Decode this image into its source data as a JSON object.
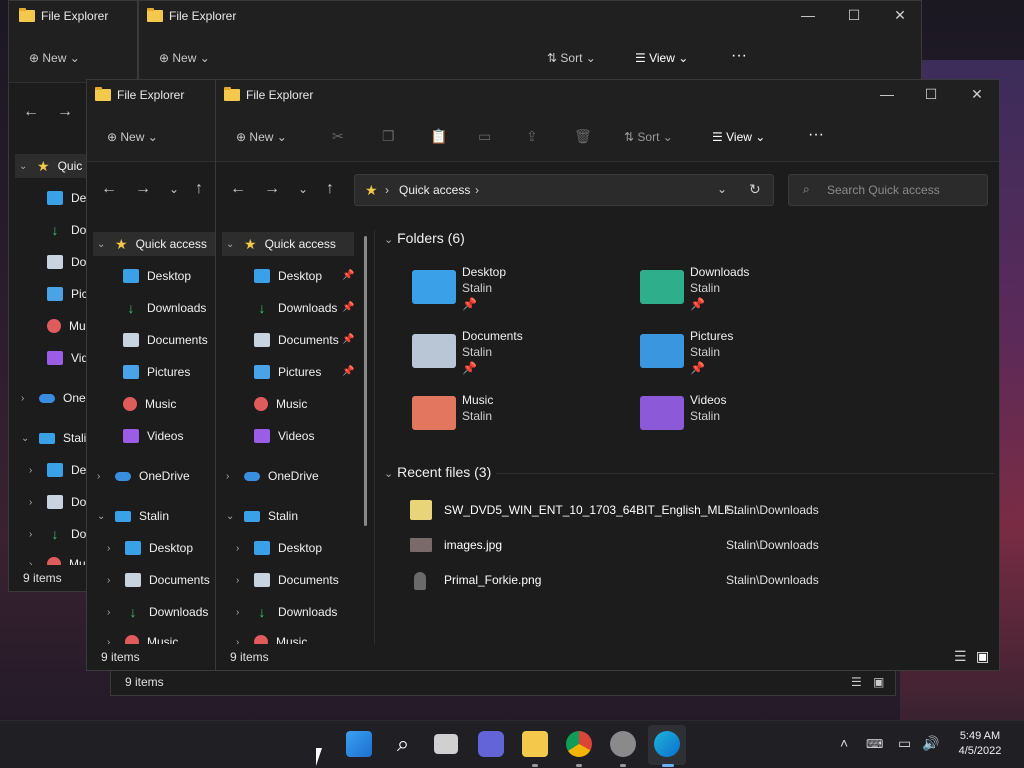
{
  "app_title": "File Explorer",
  "cmd": {
    "new": "New",
    "sort": "Sort",
    "view": "View",
    "more": "···"
  },
  "address": {
    "location": "Quick access",
    "search_placeholder": "Search Quick access"
  },
  "nav": {
    "quick_access": "Quick access",
    "items": [
      "Desktop",
      "Downloads",
      "Documents",
      "Pictures",
      "Music",
      "Videos"
    ],
    "onedrive": "OneDrive",
    "pc": "Stalin",
    "pc_items": [
      "Desktop",
      "Documents",
      "Downloads",
      "Music"
    ]
  },
  "back_nav_truncated": {
    "quick": "Quic",
    "items": [
      "Desk",
      "Dow",
      "Doc",
      "Pict",
      "Mus",
      "Vide"
    ],
    "onedrive": "OneD",
    "pc": "Stalin",
    "pc_items": [
      "Des",
      "Doc",
      "Dow",
      "Mu"
    ]
  },
  "main": {
    "folders_header": "Folders (6)",
    "folders": [
      {
        "name": "Desktop",
        "sub": "Stalin",
        "pinned": true,
        "color": "#3aa0e8"
      },
      {
        "name": "Downloads",
        "sub": "Stalin",
        "pinned": true,
        "color": "#2fae8c"
      },
      {
        "name": "Documents",
        "sub": "Stalin",
        "pinned": true,
        "color": "#b9c6d6"
      },
      {
        "name": "Pictures",
        "sub": "Stalin",
        "pinned": true,
        "color": "#3b96e0"
      },
      {
        "name": "Music",
        "sub": "Stalin",
        "pinned": false,
        "color": "#e3765f"
      },
      {
        "name": "Videos",
        "sub": "Stalin",
        "pinned": false,
        "color": "#8c5ad8"
      }
    ],
    "recent_header": "Recent files (3)",
    "recent": [
      {
        "name": "SW_DVD5_WIN_ENT_10_1703_64BIT_English_MLF...",
        "path": "Stalin\\Downloads"
      },
      {
        "name": "images.jpg",
        "path": "Stalin\\Downloads"
      },
      {
        "name": "Primal_Forkie.png",
        "path": "Stalin\\Downloads"
      }
    ]
  },
  "status": {
    "items": "9 items"
  },
  "clock": {
    "time": "5:49 AM",
    "date": "4/5/2022"
  },
  "colors": {
    "accent": "#3aa0e8",
    "star": "#f3c84b",
    "bg": "#1c1c1c"
  }
}
